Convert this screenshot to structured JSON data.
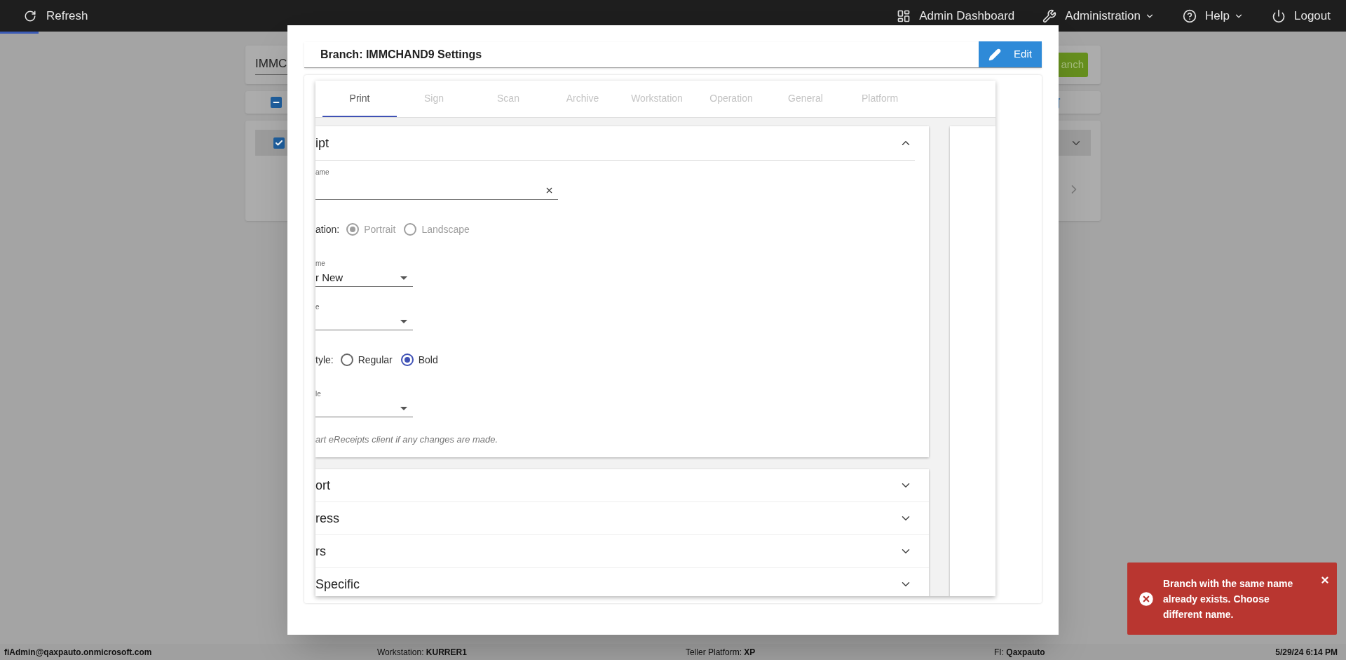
{
  "top_bar": {
    "refresh": "Refresh",
    "menu": [
      {
        "label": "Admin Dashboard",
        "dropdown": false
      },
      {
        "label": "Administration",
        "dropdown": true
      },
      {
        "label": "Help",
        "dropdown": true
      },
      {
        "label": "Logout",
        "dropdown": false
      }
    ]
  },
  "background": {
    "search_value": "IMMC",
    "button": "anch",
    "header_checkbox_indeterminate": true,
    "row_checked": true
  },
  "modal": {
    "title": "Branch: IMMCHAND9 Settings",
    "edit_button": "Edit",
    "tabs": [
      {
        "label": "Print",
        "selected": true
      },
      {
        "label": "Sign",
        "selected": false
      },
      {
        "label": "Scan",
        "selected": false
      },
      {
        "label": "Archive",
        "selected": false
      },
      {
        "label": "Workstation",
        "selected": false
      },
      {
        "label": "Operation",
        "selected": false
      },
      {
        "label": "General",
        "selected": false
      },
      {
        "label": "Platform",
        "selected": false
      }
    ],
    "receipt_section": {
      "title": "ipt",
      "expanded": true,
      "fields": [
        {
          "kind": "text",
          "label": "ame",
          "clearable": true
        },
        {
          "kind": "radio",
          "label": "ation:",
          "disabled": true,
          "options": [
            {
              "label": "Portrait",
              "selected": true
            },
            {
              "label": "Landscape",
              "selected": false
            }
          ]
        },
        {
          "kind": "select",
          "label": "me",
          "value": "r New"
        },
        {
          "kind": "select",
          "label": "e"
        },
        {
          "kind": "radio",
          "label": "tyle:",
          "disabled": false,
          "options": [
            {
              "label": "Regular",
              "selected": false
            },
            {
              "label": "Bold",
              "selected": true
            }
          ]
        },
        {
          "kind": "select",
          "label": "le"
        },
        {
          "kind": "note",
          "text": "art eReceipts client if any changes are made."
        }
      ]
    },
    "sections": [
      {
        "title": "ort",
        "expanded": false
      },
      {
        "title": "ress",
        "expanded": false
      },
      {
        "title": "rs",
        "expanded": false
      },
      {
        "title": "Specific",
        "expanded": false
      }
    ]
  },
  "status_bar": {
    "user": "fiAdmin@qaxpauto.onmicrosoft.com",
    "items": [
      "Workstation: **KURRER1**",
      "Teller Platform: **XP**",
      "FI: **Qaxpauto**"
    ],
    "datetime": "5/29/24 6:14 PM"
  },
  "toast": {
    "message": "Branch with the same name already exists. Choose different name."
  }
}
